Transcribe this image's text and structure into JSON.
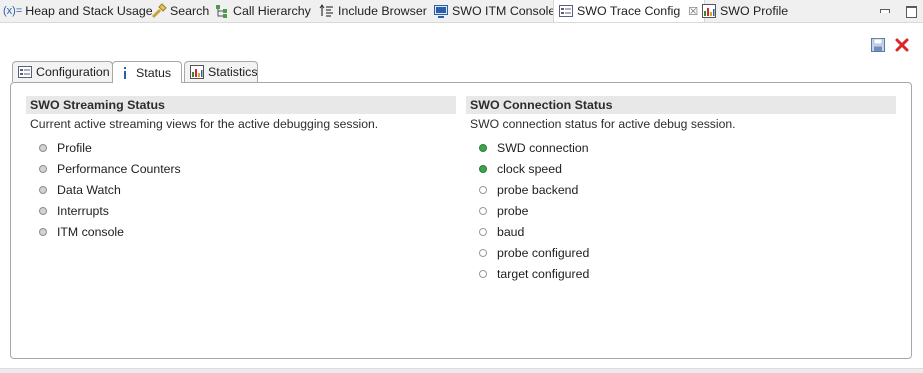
{
  "view_tabs": [
    {
      "label": "Heap and Stack Usage",
      "icon": "variable-x-icon"
    },
    {
      "label": "Search",
      "icon": "search-flashlight-icon"
    },
    {
      "label": "Call Hierarchy",
      "icon": "call-hierarchy-icon"
    },
    {
      "label": "Include Browser",
      "icon": "include-browser-icon"
    },
    {
      "label": "SWO ITM Console",
      "icon": "console-monitor-icon"
    },
    {
      "label": "SWO Trace Config",
      "icon": "trace-config-icon",
      "active": true,
      "close": "☒"
    },
    {
      "label": "SWO Profile",
      "icon": "profile-chart-icon"
    }
  ],
  "inner_tabs": [
    {
      "label": "Configuration",
      "icon": "configuration-icon"
    },
    {
      "label": "Status",
      "icon": "info-icon",
      "active": true
    },
    {
      "label": "Statistics",
      "icon": "statistics-chart-icon"
    }
  ],
  "streaming": {
    "title": "SWO Streaming Status",
    "description": "Current active streaming views for the active debugging session.",
    "items": [
      {
        "label": "Profile",
        "status": "inactive"
      },
      {
        "label": "Performance Counters",
        "status": "inactive"
      },
      {
        "label": "Data Watch",
        "status": "inactive"
      },
      {
        "label": "Interrupts",
        "status": "inactive"
      },
      {
        "label": "ITM console",
        "status": "inactive"
      }
    ]
  },
  "connection": {
    "title": "SWO Connection Status",
    "description": "SWO connection status for active debug session.",
    "items": [
      {
        "label": "SWD connection",
        "status": "ok"
      },
      {
        "label": "clock speed",
        "status": "ok"
      },
      {
        "label": "probe backend",
        "status": "none"
      },
      {
        "label": "probe",
        "status": "none"
      },
      {
        "label": "baud",
        "status": "none"
      },
      {
        "label": "probe configured",
        "status": "none"
      },
      {
        "label": "target configured",
        "status": "none"
      }
    ]
  },
  "colors": {
    "status_ok": "#3ea34a",
    "status_inactive": "#d2d2d2",
    "close_red": "#d8262b",
    "accent_blue": "#2b5fa8"
  }
}
